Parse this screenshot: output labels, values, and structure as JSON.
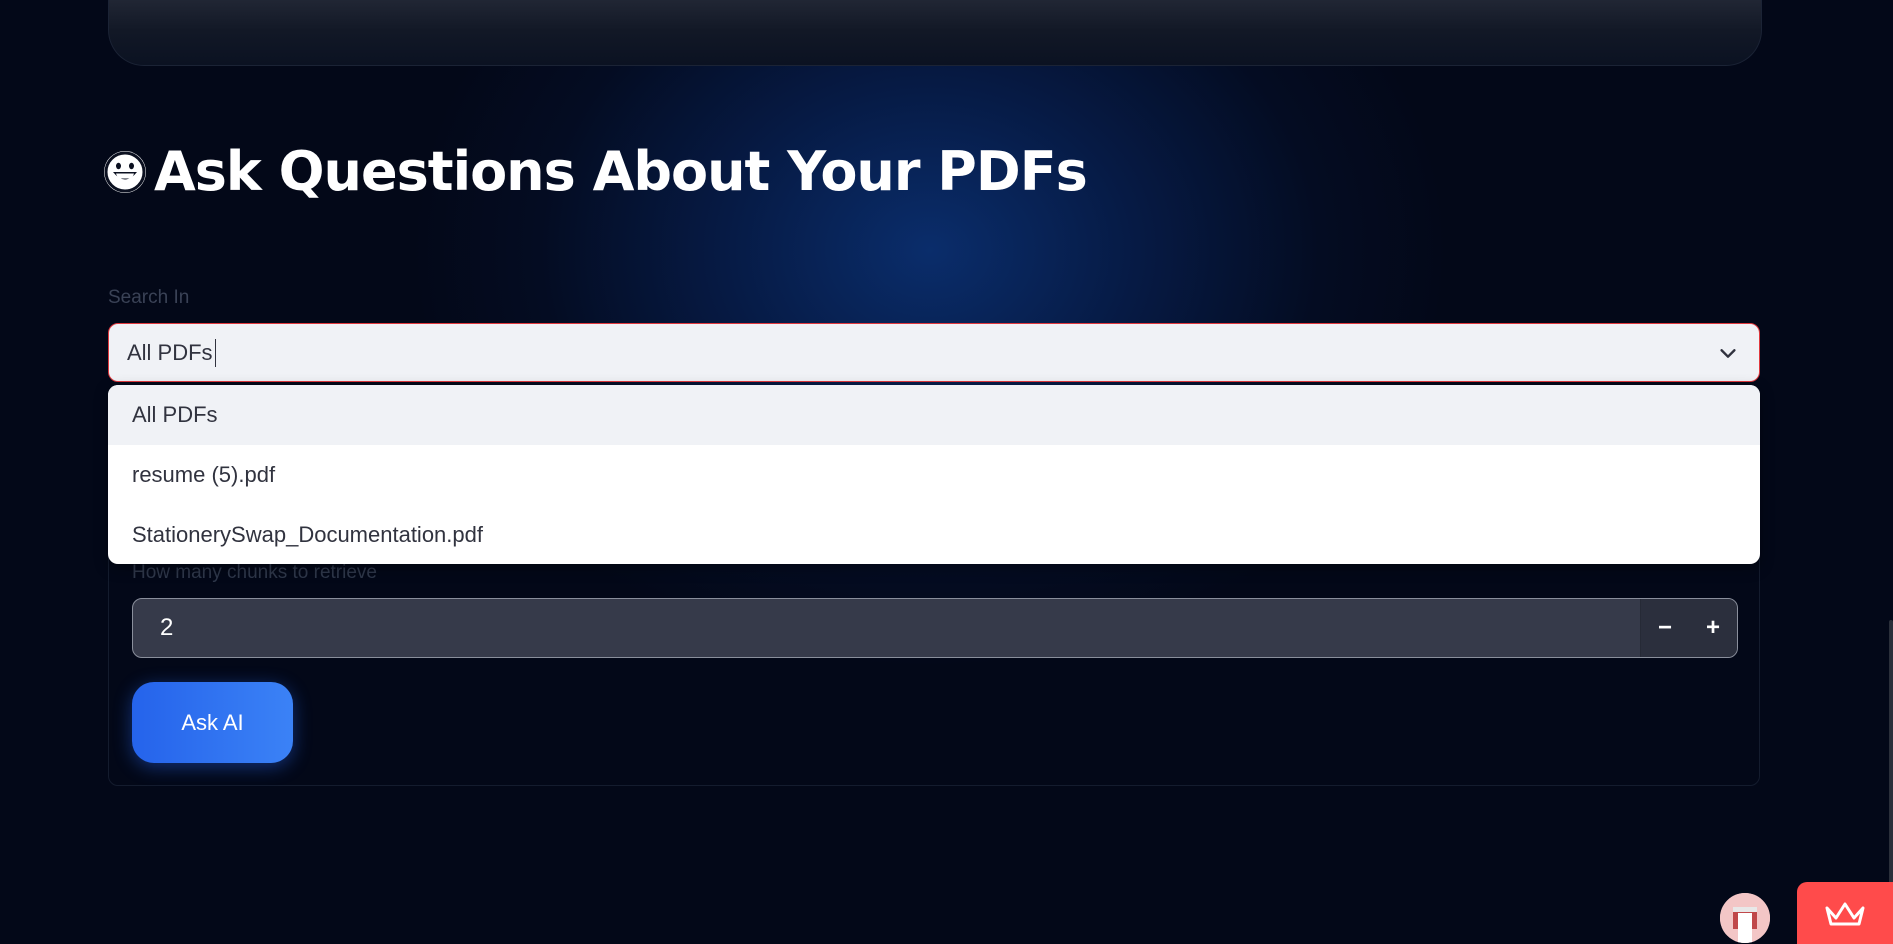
{
  "heading": {
    "title": "Ask Questions About Your PDFs",
    "icon": "grinning-face-emoji"
  },
  "search": {
    "label": "Search In",
    "selected_value": "All PDFs",
    "options": [
      "All PDFs",
      "resume (5).pdf",
      "StationerySwap_Documentation.pdf"
    ]
  },
  "chunks": {
    "label": "How many chunks to retrieve",
    "value": "2",
    "decrement_label": "−",
    "increment_label": "+"
  },
  "ask_button": {
    "label": "Ask AI"
  },
  "colors": {
    "accent": "#2563eb",
    "error_border": "#e0393e",
    "badge": "#ff4b4b"
  },
  "icons": {
    "chevron": "chevron-down-icon",
    "avatar": "user-avatar-icon",
    "badge": "streamlit-crown-icon"
  }
}
